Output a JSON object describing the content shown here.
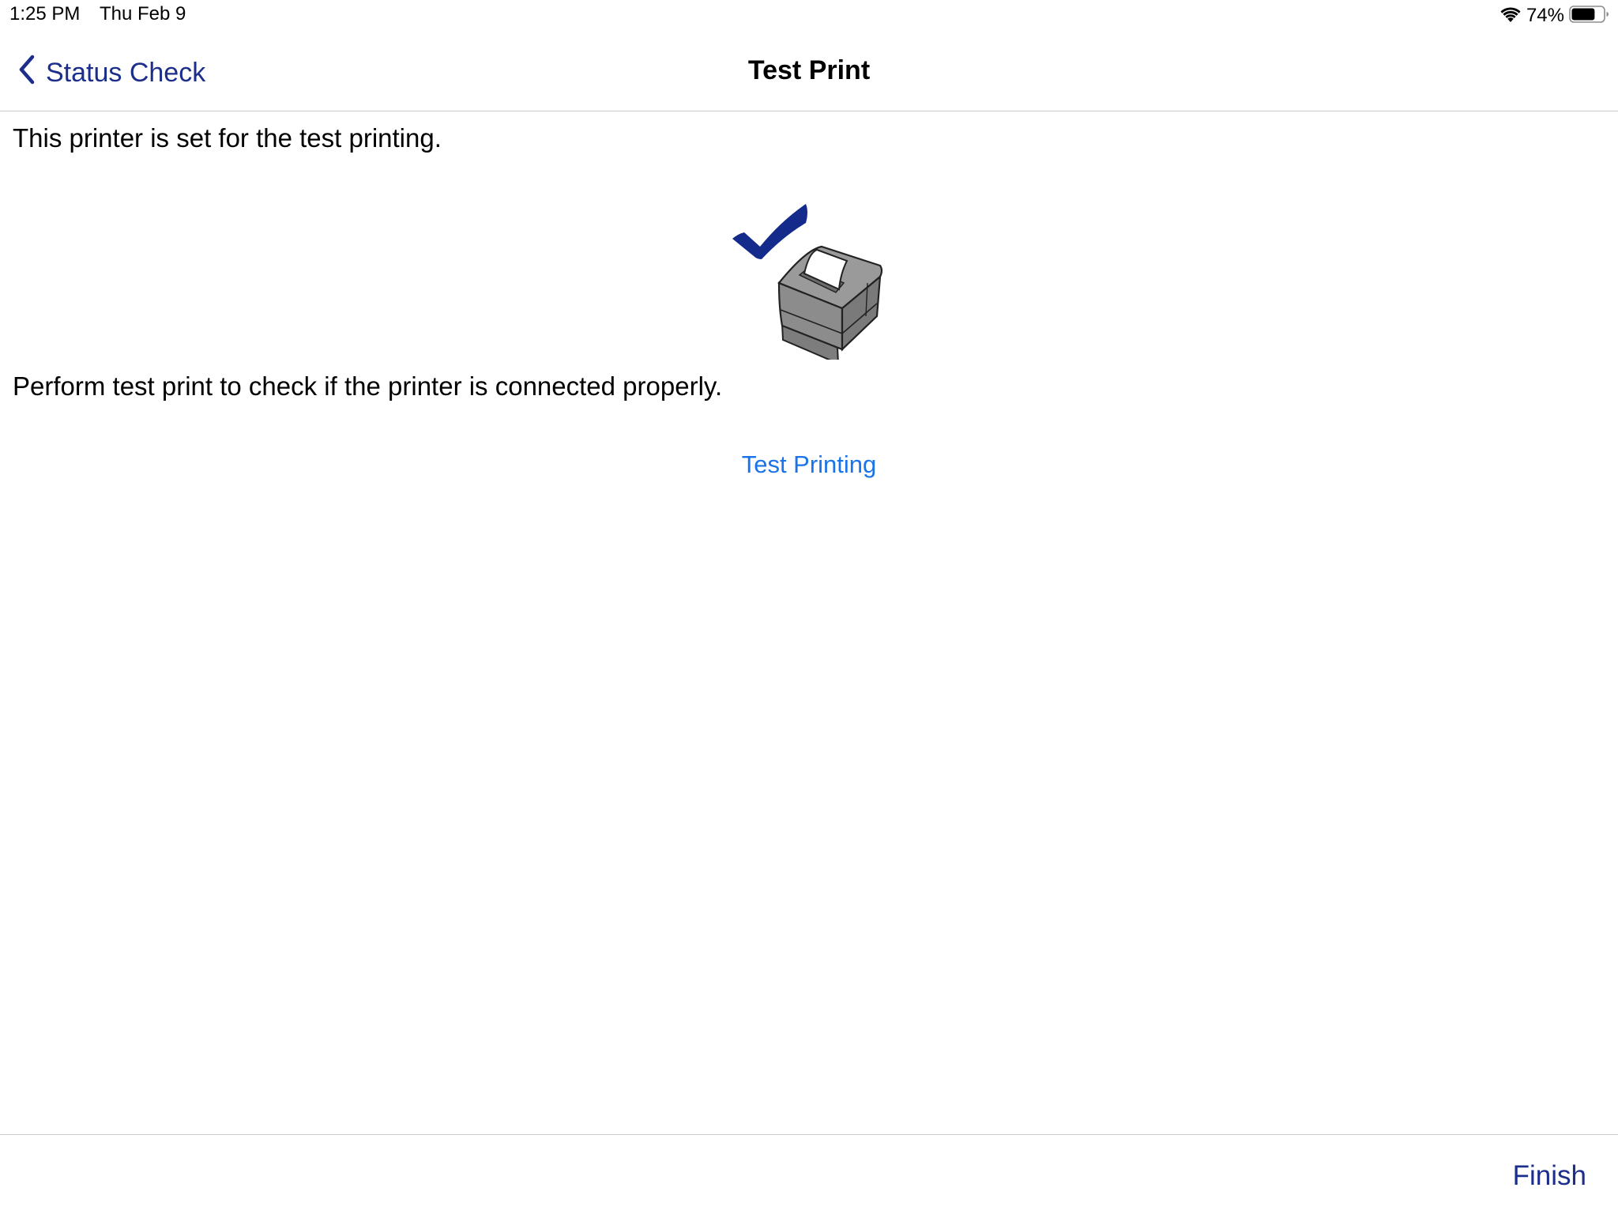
{
  "status_bar": {
    "time": "1:25 PM",
    "date": "Thu Feb 9",
    "battery_percent": "74%",
    "battery_level": 0.74,
    "wifi_icon": "wifi-icon",
    "battery_icon": "battery-icon"
  },
  "nav": {
    "back_label": "Status Check",
    "back_icon": "chevron-left-icon",
    "title": "Test Print"
  },
  "content": {
    "status_message": "This printer is set for the test printing.",
    "illustration_icon": "printer-check-icon",
    "instruction": "Perform test print to check if the printer is connected properly.",
    "test_button_label": "Test Printing"
  },
  "toolbar": {
    "finish_label": "Finish"
  },
  "colors": {
    "nav_accent": "#1c2e8c",
    "link_blue": "#1a73e8",
    "check_blue": "#142b8c",
    "printer_gray": "#8c8c8c",
    "divider": "#c8c8cc"
  }
}
